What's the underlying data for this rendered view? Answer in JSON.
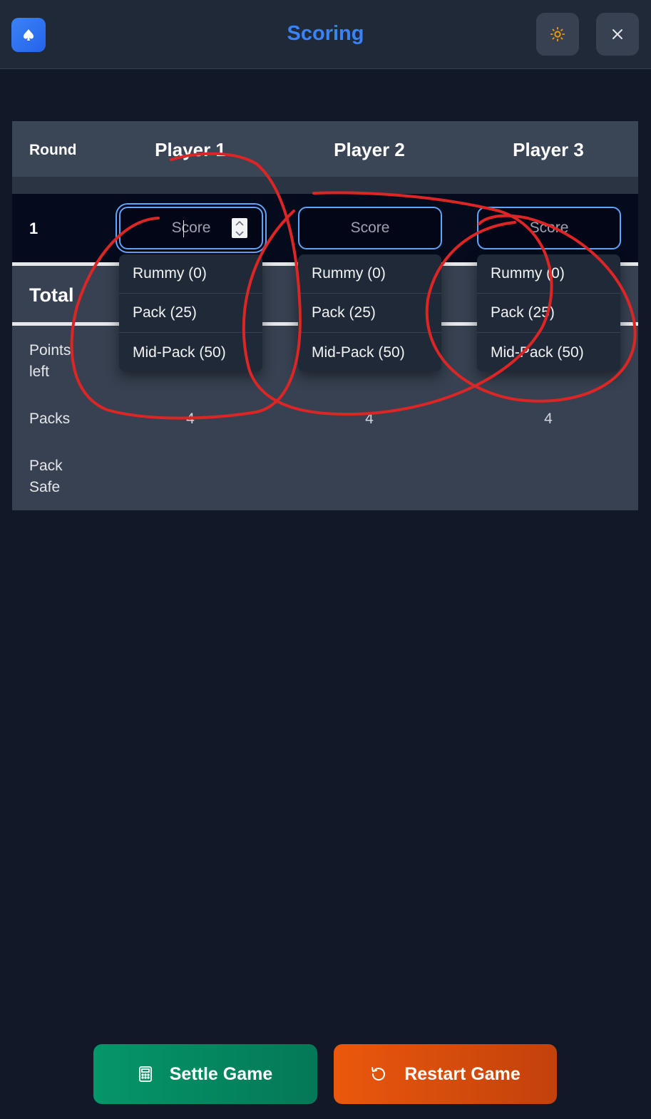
{
  "header": {
    "title": "Scoring",
    "logo_icon": "spade-icon",
    "theme_icon": "sun-icon",
    "close_icon": "close-icon",
    "accent_color": "#3b82f6"
  },
  "table": {
    "round_header": "Round",
    "players": [
      "Player 1",
      "Player 2",
      "Player 3"
    ],
    "rounds": [
      {
        "number": "1",
        "input_placeholder": "Score"
      }
    ],
    "total_label": "Total",
    "rows": {
      "points_left": {
        "label": "Points left",
        "values": [
          "",
          "",
          ""
        ]
      },
      "packs": {
        "label": "Packs",
        "values": [
          "4",
          "4",
          "4"
        ]
      },
      "pack_safe": {
        "label": "Pack Safe",
        "values": [
          "",
          "",
          ""
        ]
      }
    }
  },
  "dropdown": {
    "options": [
      "Rummy (0)",
      "Pack (25)",
      "Mid-Pack (50)"
    ]
  },
  "actions": {
    "settle_label": "Settle Game",
    "settle_icon": "calculator-icon",
    "settle_color": "#059669",
    "restart_label": "Restart Game",
    "restart_icon": "rotate-ccw-icon",
    "restart_color": "#ea580c"
  },
  "annotation_color": "#dc2626"
}
